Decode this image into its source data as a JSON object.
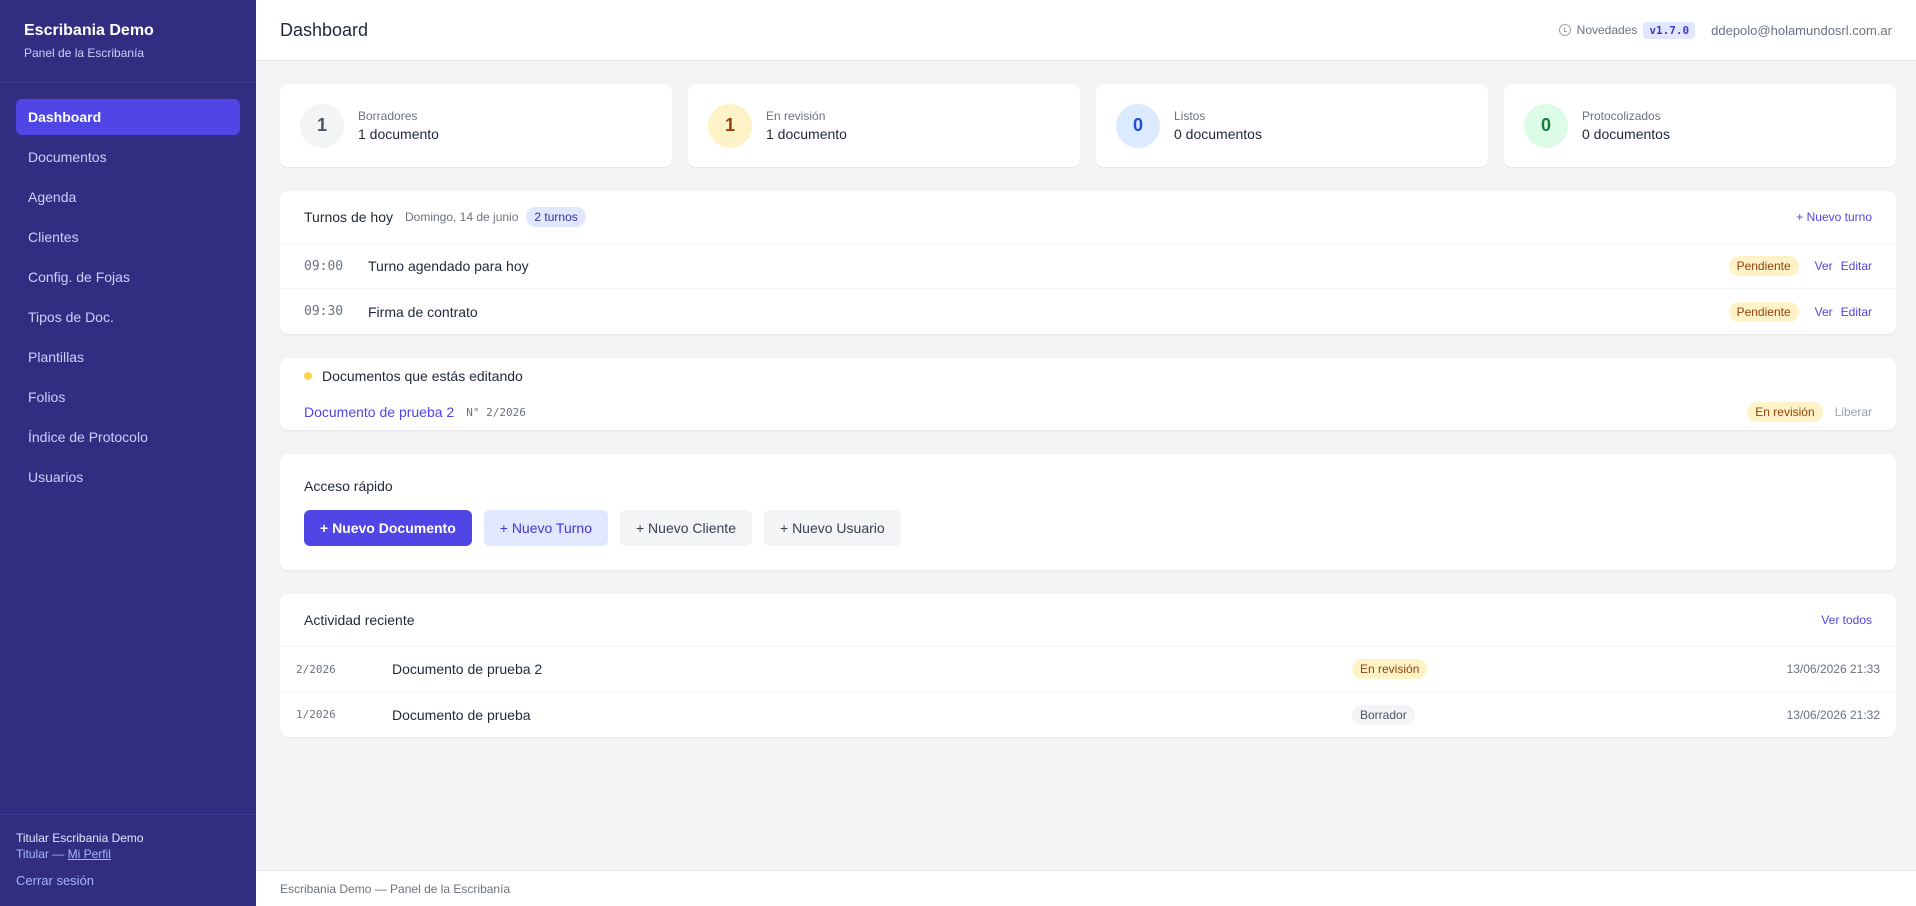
{
  "sidebar": {
    "brand_title": "Escribania Demo",
    "brand_subtitle": "Panel de la Escribanía",
    "items": [
      {
        "label": "Dashboard",
        "active": true
      },
      {
        "label": "Documentos"
      },
      {
        "label": "Agenda"
      },
      {
        "label": "Clientes"
      },
      {
        "label": "Config. de Fojas"
      },
      {
        "label": "Tipos de Doc."
      },
      {
        "label": "Plantillas"
      },
      {
        "label": "Folios"
      },
      {
        "label": "Índice de Protocolo"
      },
      {
        "label": "Usuarios"
      }
    ],
    "user_name": "Titular Escribania Demo",
    "user_role": "Titular —",
    "profile_link": "Mi Perfil",
    "logout": "Cerrar sesión"
  },
  "header": {
    "title": "Dashboard",
    "news_label": "Novedades",
    "version": "v1.7.0",
    "email": "ddepolo@holamundosrl.com.ar"
  },
  "stats": [
    {
      "count": "1",
      "label": "Borradores",
      "value": "1 documento",
      "circle_bg": "#f3f4f6",
      "circle_fg": "#4b5563"
    },
    {
      "count": "1",
      "label": "En revisión",
      "value": "1 documento",
      "circle_bg": "#fef3c7",
      "circle_fg": "#92400e"
    },
    {
      "count": "0",
      "label": "Listos",
      "value": "0 documentos",
      "circle_bg": "#dbeafe",
      "circle_fg": "#1d4ed8"
    },
    {
      "count": "0",
      "label": "Protocolizados",
      "value": "0 documentos",
      "circle_bg": "#dcfce7",
      "circle_fg": "#15803d"
    }
  ],
  "turnos": {
    "title": "Turnos de hoy",
    "date": "Domingo, 14 de junio",
    "count_badge": "2 turnos",
    "new_link": "+ Nuevo turno",
    "rows": [
      {
        "time": "09:00",
        "name": "Turno agendado para hoy",
        "status": "Pendiente",
        "ver": "Ver",
        "editar": "Editar"
      },
      {
        "time": "09:30",
        "name": "Firma de contrato",
        "status": "Pendiente",
        "ver": "Ver",
        "editar": "Editar"
      }
    ]
  },
  "editing": {
    "title": "Documentos que estás editando",
    "doc_name": "Documento de prueba 2",
    "doc_number": "N° 2/2026",
    "status": "En revisión",
    "release": "Liberar"
  },
  "quick_access": {
    "title": "Acceso rápido",
    "buttons": [
      "+ Nuevo Documento",
      "+ Nuevo Turno",
      "+ Nuevo Cliente",
      "+ Nuevo Usuario"
    ]
  },
  "activity": {
    "title": "Actividad reciente",
    "view_all": "Ver todos",
    "rows": [
      {
        "number": "2/2026",
        "name": "Documento de prueba 2",
        "status": "En revisión",
        "status_kind": "yellow",
        "time": "13/06/2026 21:33"
      },
      {
        "number": "1/2026",
        "name": "Documento de prueba",
        "status": "Borrador",
        "status_kind": "gray",
        "time": "13/06/2026 21:32"
      }
    ]
  },
  "footer": {
    "text": "Escribania Demo — Panel de la Escribanía"
  }
}
